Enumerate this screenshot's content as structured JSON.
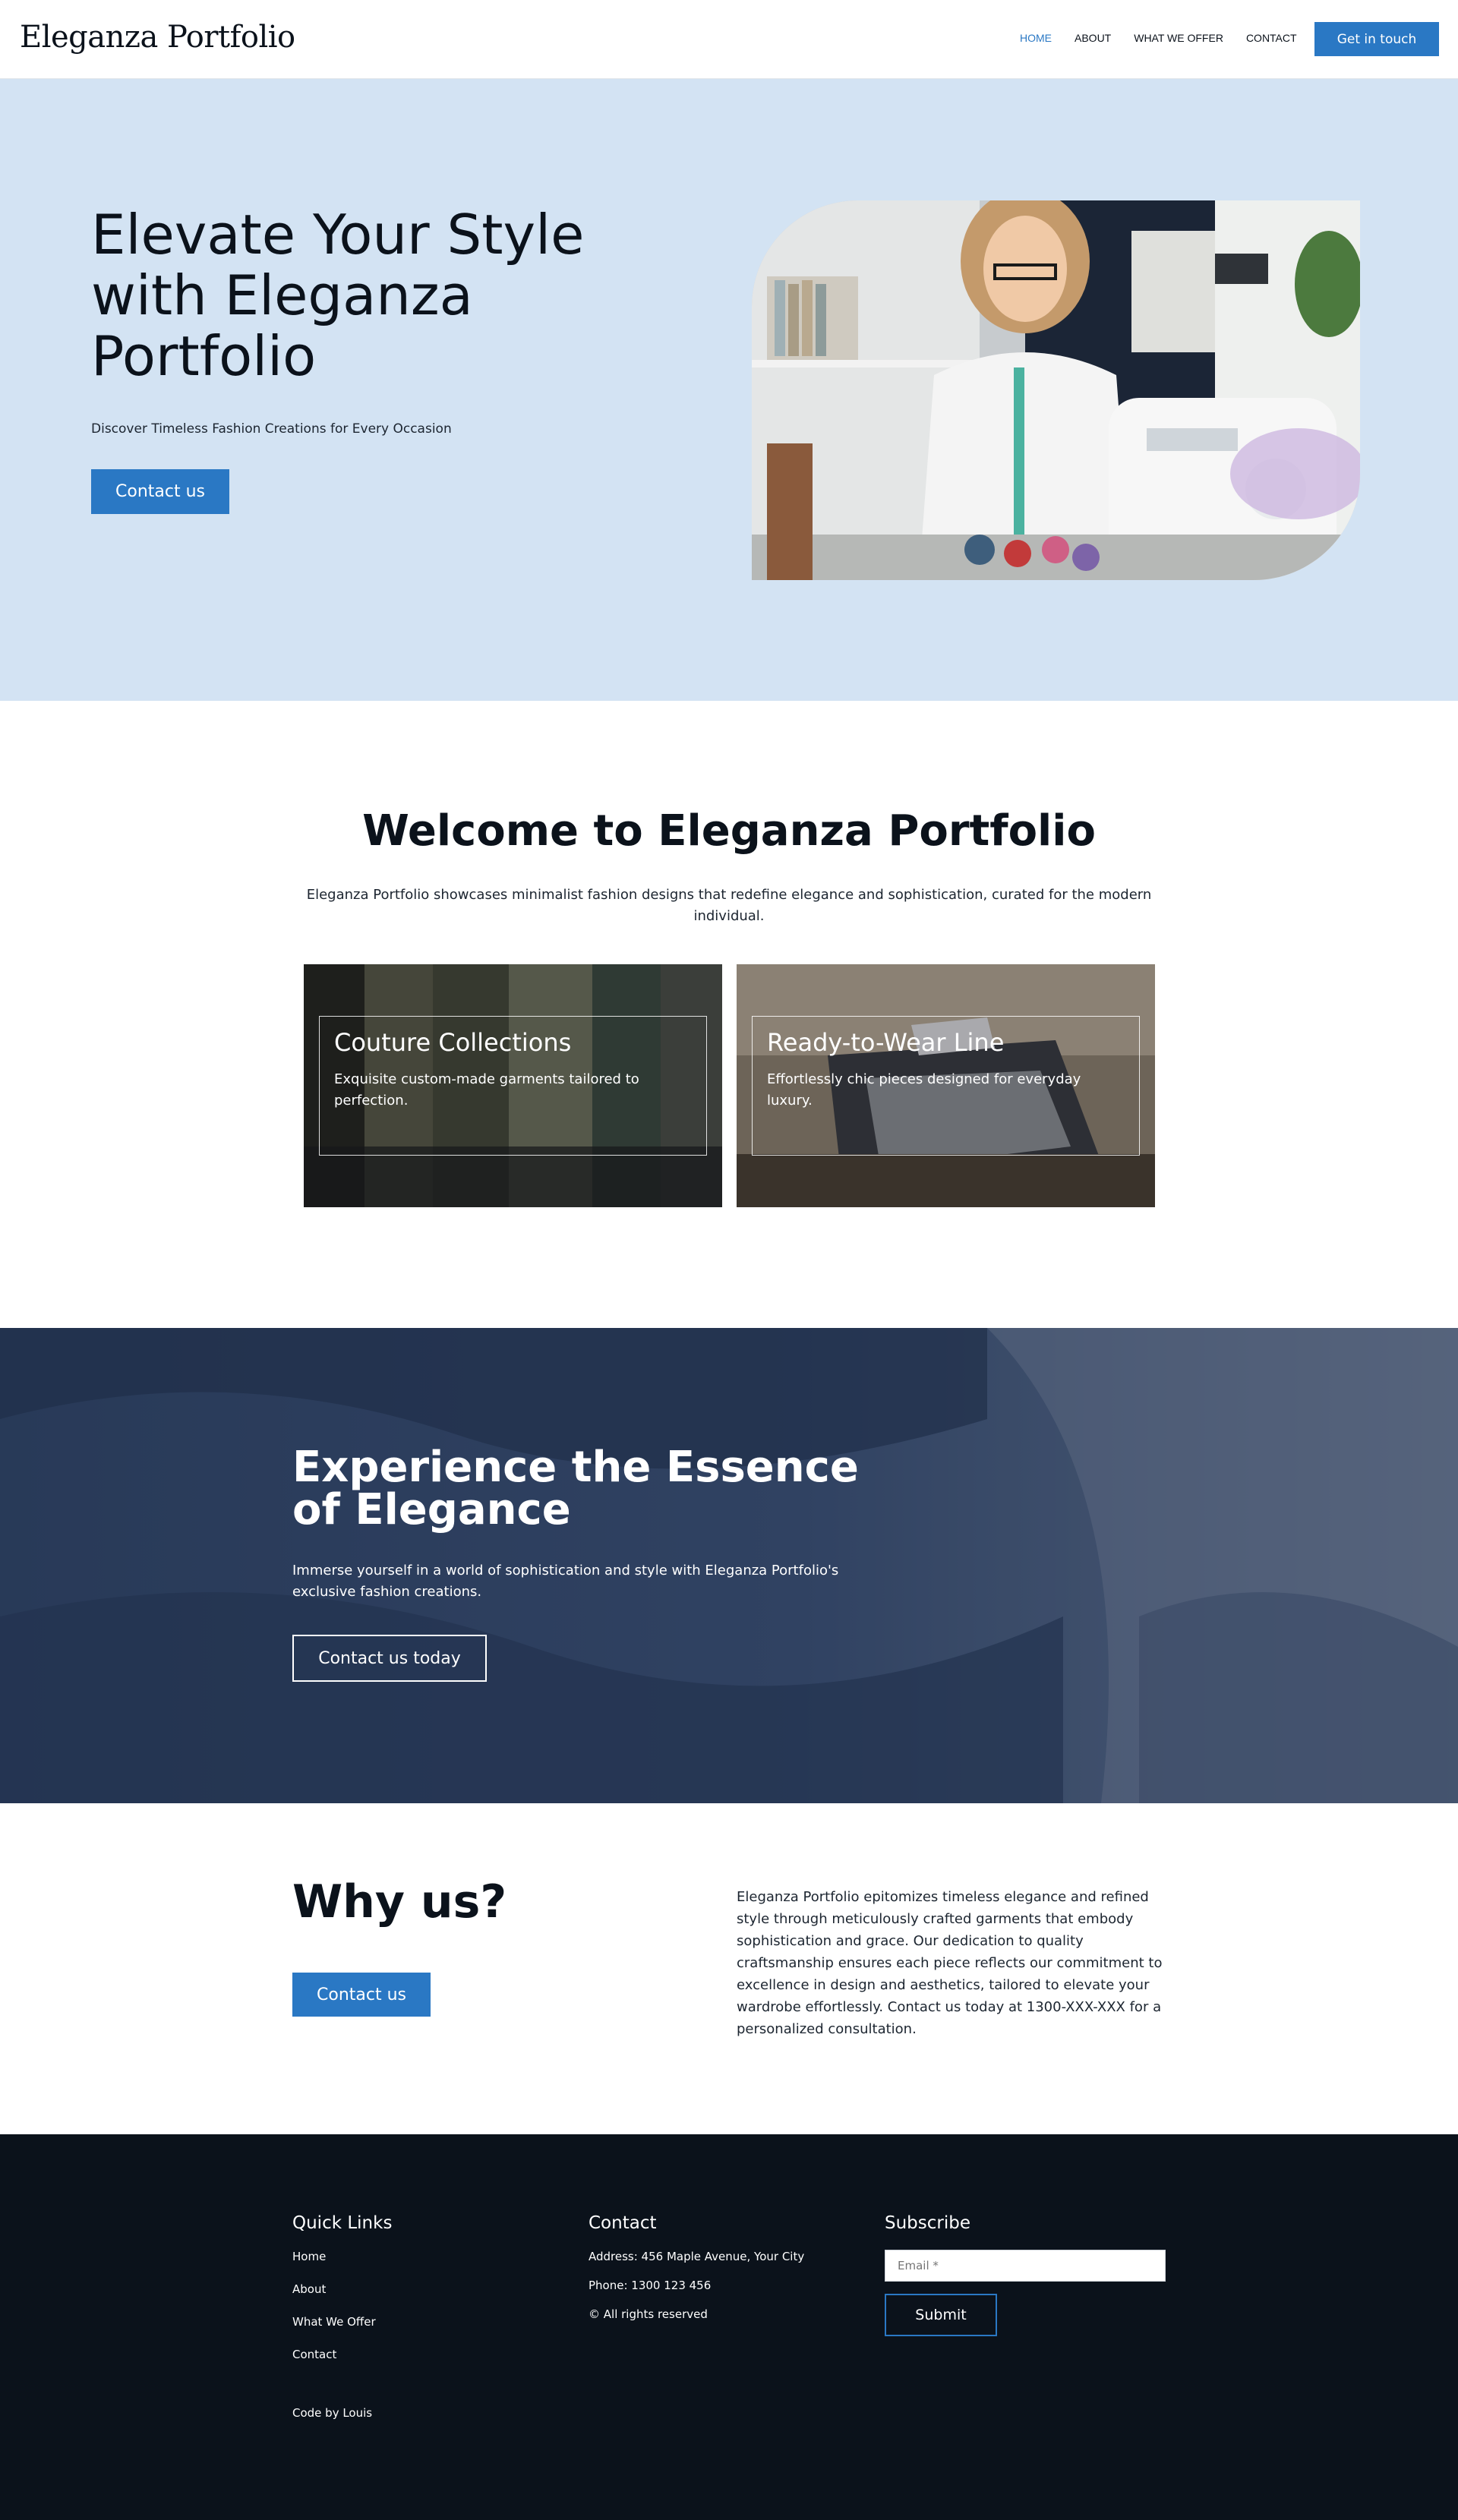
{
  "header": {
    "logo": "Eleganza Portfolio",
    "nav": [
      "HOME",
      "ABOUT",
      "WHAT WE OFFER",
      "CONTACT"
    ],
    "cta": "Get in touch"
  },
  "hero": {
    "title": "Elevate Your Style with Eleganza Portfolio",
    "subtitle": "Discover Timeless Fashion Creations for Every Occasion",
    "button": "Contact us"
  },
  "welcome": {
    "title": "Welcome to Eleganza Portfolio",
    "text": "Eleganza Portfolio showcases minimalist fashion designs that redefine elegance and sophistication, curated for the modern individual.",
    "cards": [
      {
        "title": "Couture Collections",
        "text": "Exquisite custom-made garments tailored to perfection."
      },
      {
        "title": "Ready-to-Wear Line",
        "text": "Effortlessly chic pieces designed for everyday luxury."
      }
    ]
  },
  "experience": {
    "title": "Experience the Essence of Elegance",
    "text": "Immerse yourself in a world of sophistication and style with Eleganza Portfolio's exclusive fashion creations.",
    "button": "Contact us today"
  },
  "why": {
    "title": "Why us?",
    "button": "Contact us",
    "text": "Eleganza Portfolio epitomizes timeless elegance and refined style through meticulously crafted garments that embody sophistication and grace. Our dedication to quality craftsmanship ensures each piece reflects our commitment to excellence in design and aesthetics, tailored to elevate your wardrobe effortlessly. Contact us today at 1300-XXX-XXX for a personalized consultation."
  },
  "footer": {
    "quick_links_title": "Quick Links",
    "quick_links": [
      "Home",
      "About",
      "What We Offer",
      "Contact"
    ],
    "code_by": "Code by Louis",
    "contact_title": "Contact",
    "address": "Address: 456 Maple Avenue, Your City",
    "phone": "Phone: 1300 123 456",
    "rights": "© All rights reserved",
    "subscribe_title": "Subscribe",
    "email_placeholder": "Email *",
    "submit": "Submit"
  },
  "colors": {
    "accent": "#2a78c4",
    "hero_bg": "#d3e3f3",
    "footer_bg": "#0b121b"
  }
}
